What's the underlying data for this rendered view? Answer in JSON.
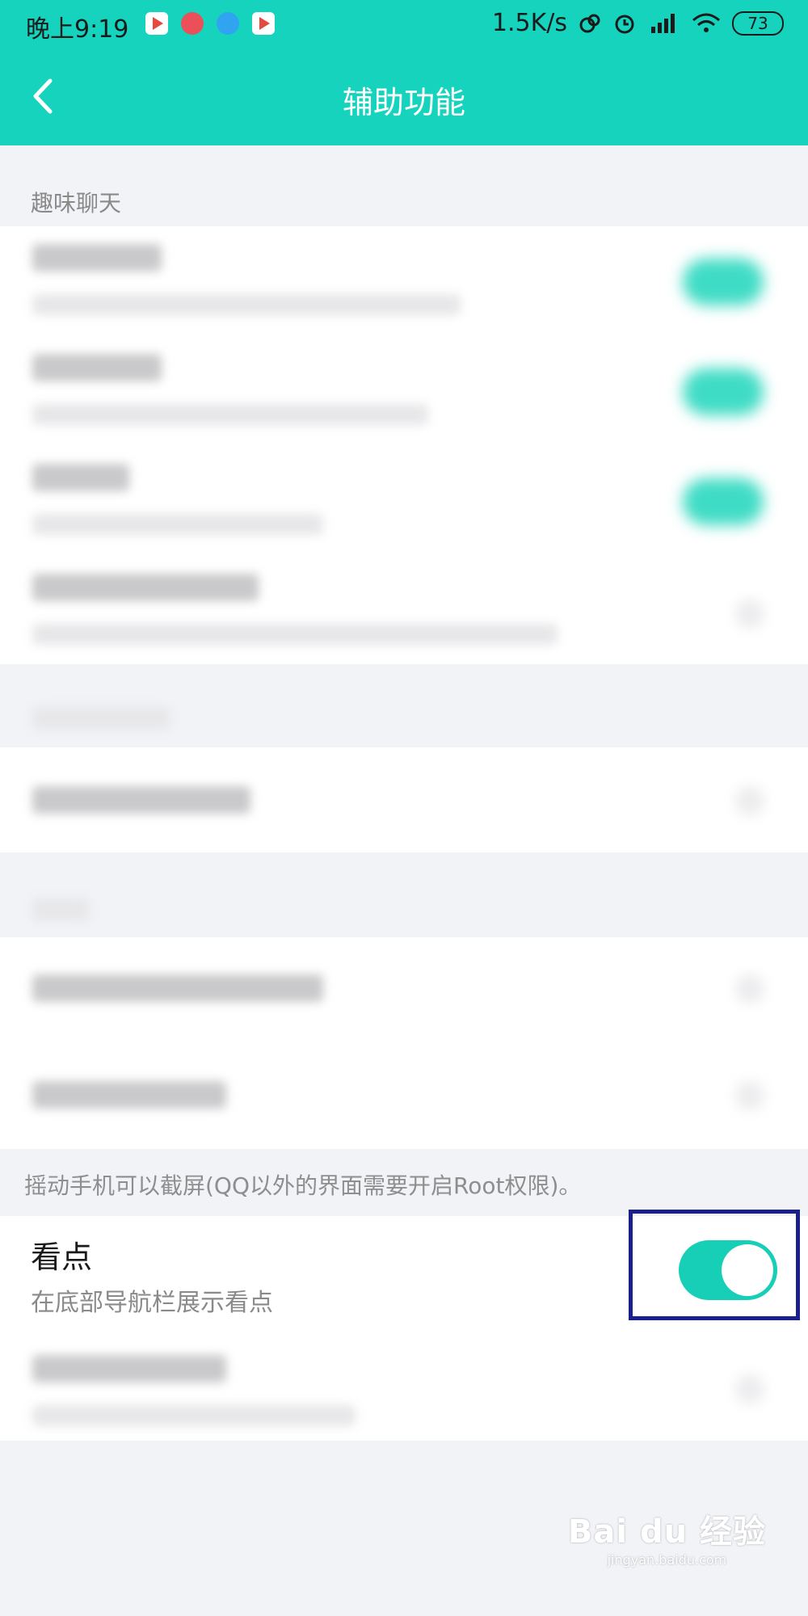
{
  "status_bar": {
    "time": "晚上9:19",
    "network_speed": "1.5K/s",
    "battery": "73",
    "icons": [
      "play-store-icon",
      "music-icon",
      "feather-icon",
      "play-store-icon",
      "link-icon",
      "alarm-icon",
      "signal-icon",
      "wifi-icon",
      "battery-icon"
    ]
  },
  "header": {
    "title": "辅助功能",
    "back_icon": "chevron-left-icon"
  },
  "sections": {
    "fun_chat_label": "趣味聊天"
  },
  "shake_description": "摇动手机可以截屏(QQ以外的界面需要开启Root权限)。",
  "kandian": {
    "title": "看点",
    "subtitle": "在底部导航栏展示看点",
    "toggle_on": true
  },
  "watermark": {
    "brand": "Bai du 经验",
    "domain": "jingyan.baidu.com"
  },
  "colors": {
    "accent": "#16d3bd",
    "toggle_on": "#16cfb6",
    "highlight_border": "#1a1f8c"
  }
}
